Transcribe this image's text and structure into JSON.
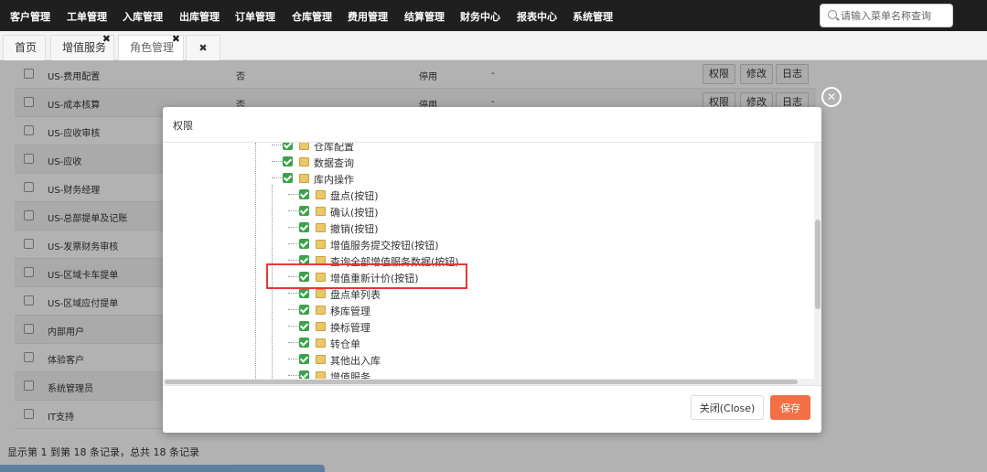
{
  "nav": {
    "items": [
      "客户管理",
      "工单管理",
      "入库管理",
      "出库管理",
      "订单管理",
      "仓库管理",
      "费用管理",
      "结算管理",
      "财务中心",
      "报表中心",
      "系统管理"
    ]
  },
  "search": {
    "placeholder": "请输入菜单名称查询",
    "icon": "search-icon"
  },
  "tabs": {
    "home": "首页",
    "value_service": "增值服务",
    "role_mgmt": "角色管理"
  },
  "table": {
    "rows": [
      {
        "name": "US-费用配置",
        "col2": "否",
        "col3": "停用",
        "col4": "-"
      },
      {
        "name": "US-成本核算",
        "col2": "否",
        "col3": "停用",
        "col4": "-"
      },
      {
        "name": "US-应收审核"
      },
      {
        "name": "US-应收"
      },
      {
        "name": "US-财务经理"
      },
      {
        "name": "US-总部提单及记账"
      },
      {
        "name": "US-发票财务审核"
      },
      {
        "name": "US-区域卡车提单"
      },
      {
        "name": "US-区域应付提单"
      },
      {
        "name": "内部用户"
      },
      {
        "name": "体验客户"
      },
      {
        "name": "系统管理员"
      },
      {
        "name": "IT支持"
      }
    ],
    "actions": {
      "perm": "权限",
      "edit": "修改",
      "log": "日志"
    }
  },
  "footer": {
    "records": "显示第 1 到第 18 条记录，总共 18 条记录"
  },
  "modal": {
    "title": "权限",
    "tree": {
      "warehouse_config": "仓库配置",
      "data_query": "数据查询",
      "inner_ops": "库内操作",
      "children": [
        "盘点(按钮)",
        "确认(按钮)",
        "撤销(按钮)",
        "增值服务提交按钮(按钮)",
        "查询全部增值服务数据(按钮)",
        "增值重新计价(按钮)",
        "盘点单列表",
        "移库管理",
        "换标管理",
        "转仓单",
        "其他出入库",
        "增值服务"
      ]
    },
    "close_button": "关闭(Close)",
    "save_button": "保存"
  },
  "colors": {
    "topnav": "#1f1f1f",
    "save": "#f36f46",
    "check": "#3aa34a",
    "highlight": "#e53935"
  }
}
